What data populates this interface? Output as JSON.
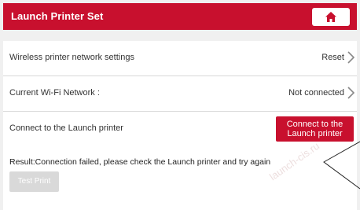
{
  "header": {
    "title": "Launch Printer Set",
    "home_icon": "home-icon"
  },
  "rows": {
    "wireless": {
      "label": "Wireless printer network settings",
      "value": "Reset"
    },
    "wifi": {
      "label": "Current Wi-Fi Network :",
      "value": "Not connected"
    },
    "connect": {
      "label": "Connect to the Launch printer",
      "button_line1": "Connect to the",
      "button_line2": "Launch printer"
    }
  },
  "result_text": "Result:Connection failed, please check the Launch printer and try again",
  "test_print_label": "Test Print",
  "watermark": "launch-cis.ru",
  "colors": {
    "accent": "#c8102e",
    "disabled": "#d9d9d9"
  }
}
